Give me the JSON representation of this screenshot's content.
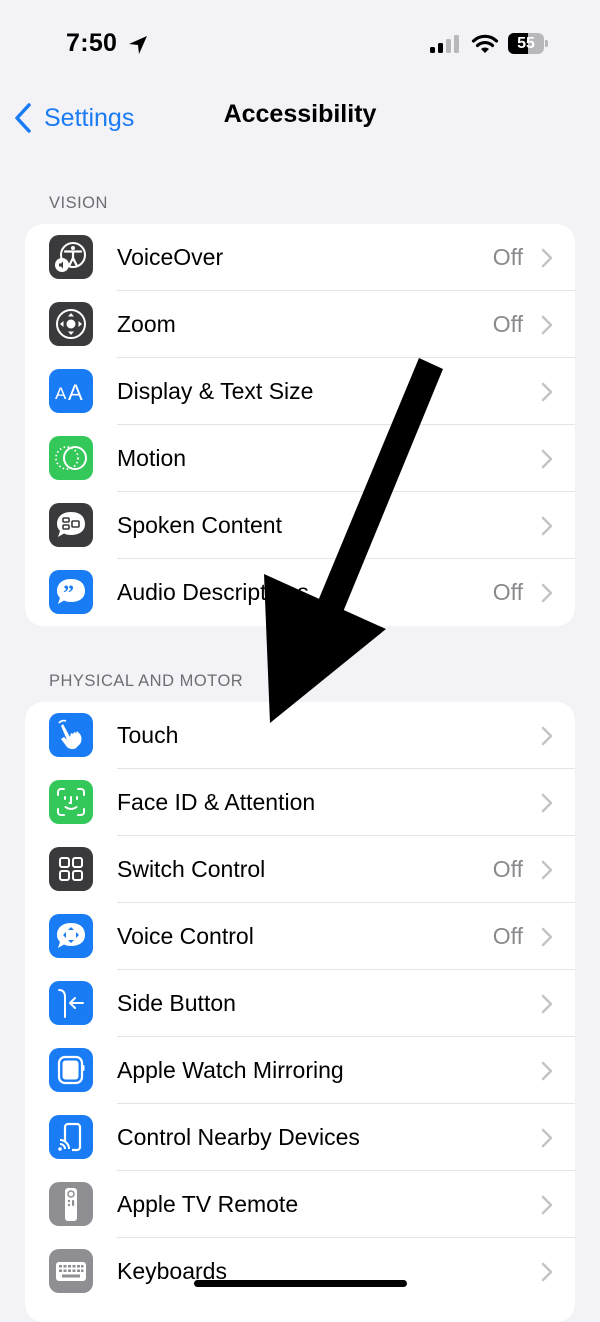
{
  "status_bar": {
    "time": "7:50",
    "battery_level": "55",
    "battery_fraction": 0.55,
    "icons": [
      "location-arrow-icon",
      "cellular-signal-icon",
      "wifi-icon",
      "battery-icon"
    ]
  },
  "nav": {
    "back_label": "Settings",
    "title": "Accessibility"
  },
  "colors": {
    "accent_blue": "#1a7cf5",
    "icon_gray_dark": "#3a3a3c",
    "icon_blue": "#1a7cf5",
    "icon_green": "#34c759",
    "icon_gray_light": "#8e8e93",
    "background": "#f2f2f7"
  },
  "sections": [
    {
      "header": "VISION",
      "items": [
        {
          "label": "VoiceOver",
          "value": "Off",
          "icon": "voiceover-icon"
        },
        {
          "label": "Zoom",
          "value": "Off",
          "icon": "zoom-icon"
        },
        {
          "label": "Display & Text Size",
          "value": "",
          "icon": "display-text-size-icon"
        },
        {
          "label": "Motion",
          "value": "",
          "icon": "motion-icon"
        },
        {
          "label": "Spoken Content",
          "value": "",
          "icon": "spoken-content-icon"
        },
        {
          "label": "Audio Descriptions",
          "value": "Off",
          "icon": "audio-descriptions-icon"
        }
      ]
    },
    {
      "header": "PHYSICAL AND MOTOR",
      "items": [
        {
          "label": "Touch",
          "value": "",
          "icon": "touch-icon"
        },
        {
          "label": "Face ID & Attention",
          "value": "",
          "icon": "face-id-icon"
        },
        {
          "label": "Switch Control",
          "value": "Off",
          "icon": "switch-control-icon"
        },
        {
          "label": "Voice Control",
          "value": "Off",
          "icon": "voice-control-icon"
        },
        {
          "label": "Side Button",
          "value": "",
          "icon": "side-button-icon"
        },
        {
          "label": "Apple Watch Mirroring",
          "value": "",
          "icon": "apple-watch-icon"
        },
        {
          "label": "Control Nearby Devices",
          "value": "",
          "icon": "nearby-devices-icon"
        },
        {
          "label": "Apple TV Remote",
          "value": "",
          "icon": "tv-remote-icon"
        },
        {
          "label": "Keyboards",
          "value": "",
          "icon": "keyboard-icon"
        }
      ]
    }
  ],
  "annotation": {
    "type": "arrow",
    "points_to": "Touch"
  }
}
